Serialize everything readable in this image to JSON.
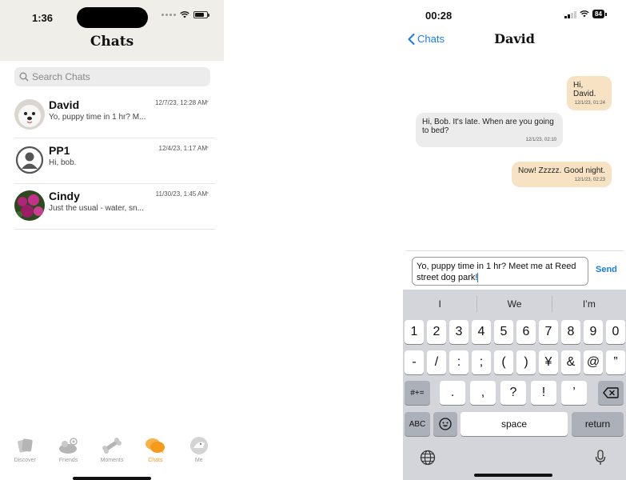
{
  "left": {
    "status": {
      "time": "1:36"
    },
    "title": "Chats",
    "search_placeholder": "Search Chats",
    "chats": [
      {
        "name": "David",
        "preview": "Yo, puppy time in 1 hr? M...",
        "time": "12/7/23, 12:28 AM",
        "chevron": ">"
      },
      {
        "name": "PP1",
        "preview": "Hi, bob.",
        "time": "12/4/23, 1:17 AM",
        "chevron": ">"
      },
      {
        "name": "Cindy",
        "preview": "Just the usual - water, sn...",
        "time": "11/30/23, 1:45 AM",
        "chevron": ">"
      }
    ],
    "tabs": [
      {
        "label": "Discover",
        "icon": "discover-icon"
      },
      {
        "label": "Friends",
        "icon": "friends-icon"
      },
      {
        "label": "Moments",
        "icon": "moments-icon"
      },
      {
        "label": "Chats",
        "icon": "chats-icon",
        "active": true
      },
      {
        "label": "Me",
        "icon": "me-icon"
      }
    ],
    "accent_color": "#f59a1a"
  },
  "right": {
    "status": {
      "time": "00:28",
      "battery": "84"
    },
    "back_label": "Chats",
    "title": "David",
    "messages": [
      {
        "direction": "out",
        "text": "Hi, David.",
        "time": "12/1/23, 01:24"
      },
      {
        "direction": "in",
        "text": "Hi, Bob. It's late. When are you going to bed?",
        "time": "12/1/23, 02:10"
      },
      {
        "direction": "out",
        "text": "Now! Zzzzz. Good night.",
        "time": "12/1/23, 02:23"
      }
    ],
    "input_value": "Yo, puppy time in 1 hr? Meet me at Reed street dog park!",
    "send_label": "Send",
    "keyboard": {
      "suggestions": [
        "I",
        "We",
        "I’m"
      ],
      "row1": [
        "1",
        "2",
        "3",
        "4",
        "5",
        "6",
        "7",
        "8",
        "9",
        "0"
      ],
      "row2": [
        "-",
        "/",
        ":",
        ";",
        "(",
        ")",
        "¥",
        "&",
        "@",
        "”"
      ],
      "row3": [
        ".",
        ",",
        "?",
        "!",
        "’"
      ],
      "shift_label": "#+=",
      "abc_label": "ABC",
      "space_label": "space",
      "return_label": "return"
    },
    "accent_color": "#1a7ce8",
    "outgoing_bubble_color": "#f7e3c4",
    "incoming_bubble_color": "#ececec"
  }
}
